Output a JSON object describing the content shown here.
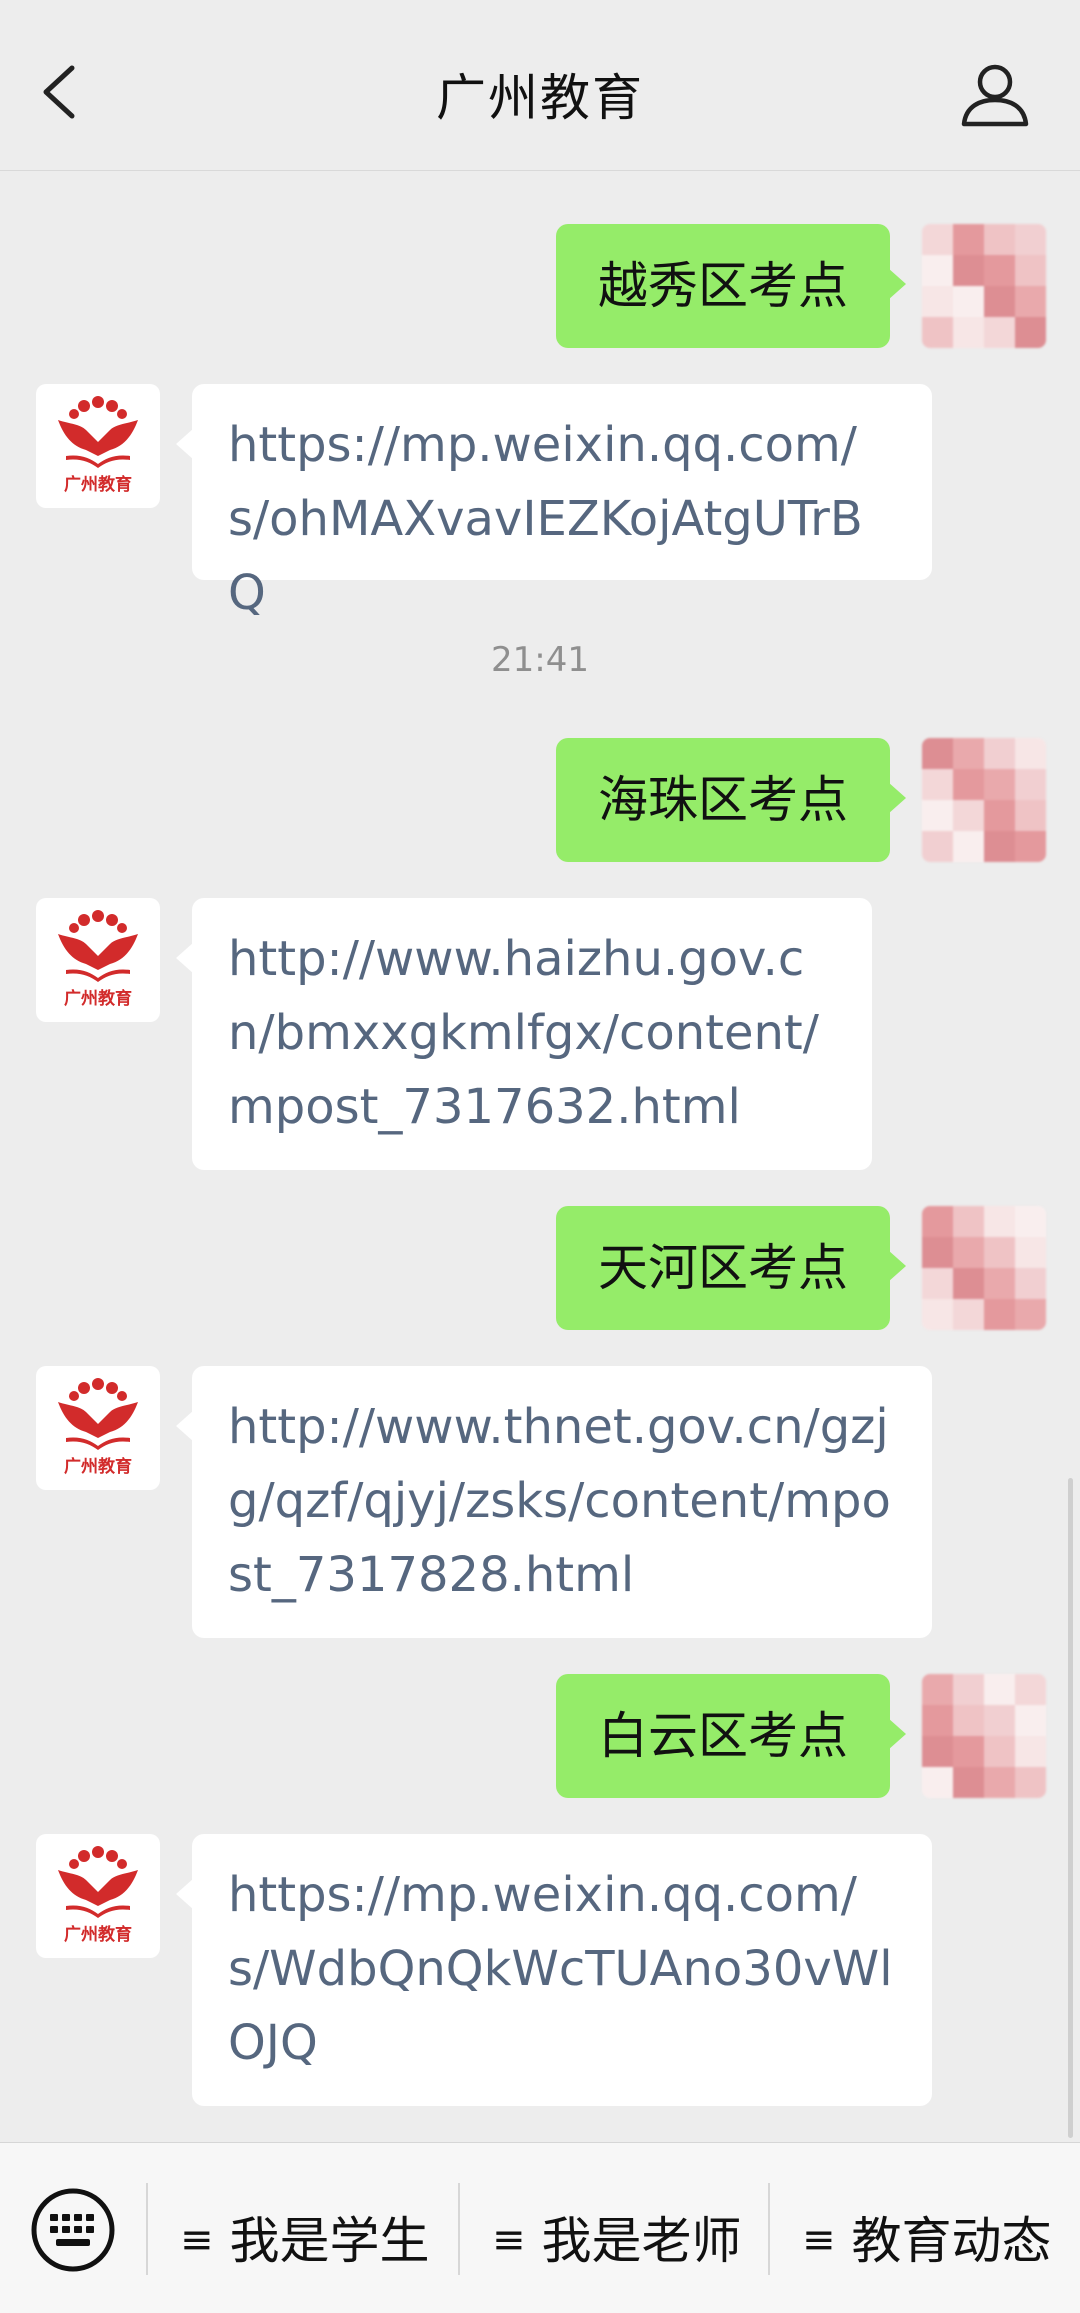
{
  "header": {
    "title": "广州教育",
    "back_icon": "chevron-left-icon",
    "profile_icon": "person-icon"
  },
  "messages": [
    {
      "type": "out",
      "text": "越秀区考点"
    },
    {
      "type": "in",
      "text": "https://mp.weixin.qq.com/s/ohMAXvavIEZKojAtgUTrBQ"
    },
    {
      "type": "time",
      "text": "21:41"
    },
    {
      "type": "out",
      "text": "海珠区考点"
    },
    {
      "type": "in",
      "text": "http://www.haizhu.gov.cn/bmxxgkmlfgx/content/mpost_7317632.html"
    },
    {
      "type": "out",
      "text": "天河区考点"
    },
    {
      "type": "in",
      "text": "http://www.thnet.gov.cn/gzjg/qzf/qjyj/zsks/content/mpost_7317828.html"
    },
    {
      "type": "out",
      "text": "白云区考点"
    },
    {
      "type": "in",
      "text": "https://mp.weixin.qq.com/s/WdbQnQkWcTUAno30vWlOJQ"
    }
  ],
  "org_avatar": {
    "label": "广州教育",
    "brand_color": "#d22b2b"
  },
  "bottom_menu": {
    "keyboard_icon": "keyboard-icon",
    "items": [
      {
        "icon": "≡",
        "label": "我是学生"
      },
      {
        "icon": "≡",
        "label": "我是老师"
      },
      {
        "icon": "≡",
        "label": "教育动态"
      }
    ]
  },
  "colors": {
    "outgoing_bubble": "#95ec69",
    "incoming_bubble": "#ffffff",
    "link_text": "#56677f",
    "background": "#ededed"
  }
}
